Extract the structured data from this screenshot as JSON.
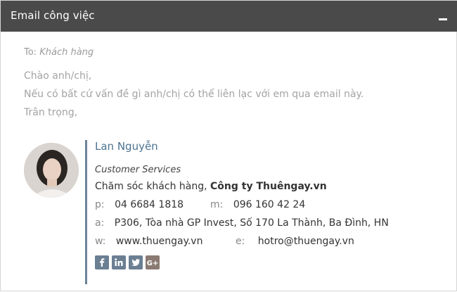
{
  "window": {
    "title": "Email công việc"
  },
  "email": {
    "to_label": "To:",
    "to_value": "Khách hàng",
    "lines": [
      "Chào anh/chị,",
      "Nếu có bất cứ vấn đề gì anh/chị có thể liên lạc với em qua email này.",
      "Trân trọng,"
    ]
  },
  "signature": {
    "name": "Lan Nguyễn",
    "role": "Customer Services",
    "department": "Chăm sóc khách hàng,",
    "company": "Công ty Thuêngay.vn",
    "phone_label": "p:",
    "phone": "04 6684 1818",
    "mobile_label": "m:",
    "mobile": "096 160 42 24",
    "address_label": "a:",
    "address": "P306, Tòa nhà GP Invest, Số 170 La Thành, Ba Đình, HN",
    "web_label": "w:",
    "web": "www.thuengay.vn",
    "email_label": "e:",
    "email": "hotro@thuengay.vn",
    "social": [
      {
        "icon": "facebook-icon",
        "text": "f"
      },
      {
        "icon": "linkedin-icon",
        "text": "in"
      },
      {
        "icon": "twitter-icon",
        "text": "t"
      },
      {
        "icon": "google-plus-icon",
        "text": "G+"
      }
    ]
  },
  "colors": {
    "titlebar": "#4a4a4a",
    "name_accent": "#4d7391",
    "rule": "#6d8398"
  }
}
